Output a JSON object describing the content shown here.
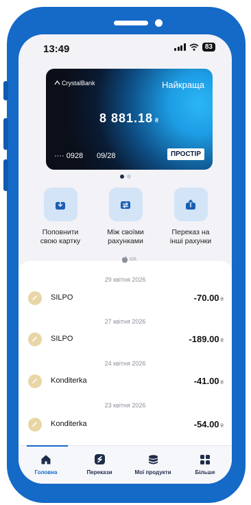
{
  "status_bar": {
    "time": "13:49",
    "battery": "83"
  },
  "card": {
    "bank_name": "CrystalBank",
    "tag": "Найкраща",
    "balance": "8 881.18",
    "currency": "₴",
    "number_masked": "···· 0928",
    "expiry": "09/28",
    "network": "ПРОСТІР"
  },
  "carousel": {
    "pages": 2,
    "active_page": 1
  },
  "actions": [
    {
      "label_line1": "Поповнити",
      "label_line2": "свою картку",
      "icon": "download-tray-icon"
    },
    {
      "label_line1": "Між своїми",
      "label_line2": "рахунками",
      "icon": "transfer-arrows-icon"
    },
    {
      "label_line1": "Переказ на",
      "label_line2": "інші рахунки",
      "icon": "upload-tray-icon"
    }
  ],
  "platform_mark": "iOS",
  "transactions": [
    {
      "date": "29 квітня 2026",
      "name": "SILPO",
      "amount": "-70.00",
      "currency": "₴"
    },
    {
      "date": "27 квітня 2026",
      "name": "SILPO",
      "amount": "-189.00",
      "currency": "₴"
    },
    {
      "date": "24 квітня 2026",
      "name": "Konditerka",
      "amount": "-41.00",
      "currency": "₴"
    },
    {
      "date": "23 квітня 2026",
      "name": "Konditerka",
      "amount": "-54.00",
      "currency": "₴"
    }
  ],
  "tabbar": {
    "active": 0,
    "tabs": [
      {
        "label": "Головна",
        "icon": "home-icon"
      },
      {
        "label": "Перекази",
        "icon": "transfers-icon"
      },
      {
        "label": "Мої продукти",
        "icon": "products-icon"
      },
      {
        "label": "Більше",
        "icon": "grid-more-icon"
      }
    ]
  },
  "colors": {
    "frame": "#1569c7",
    "accent": "#1569c7",
    "action_bg": "#d3e4f6",
    "merchant_icon": "#e8d6a6"
  }
}
